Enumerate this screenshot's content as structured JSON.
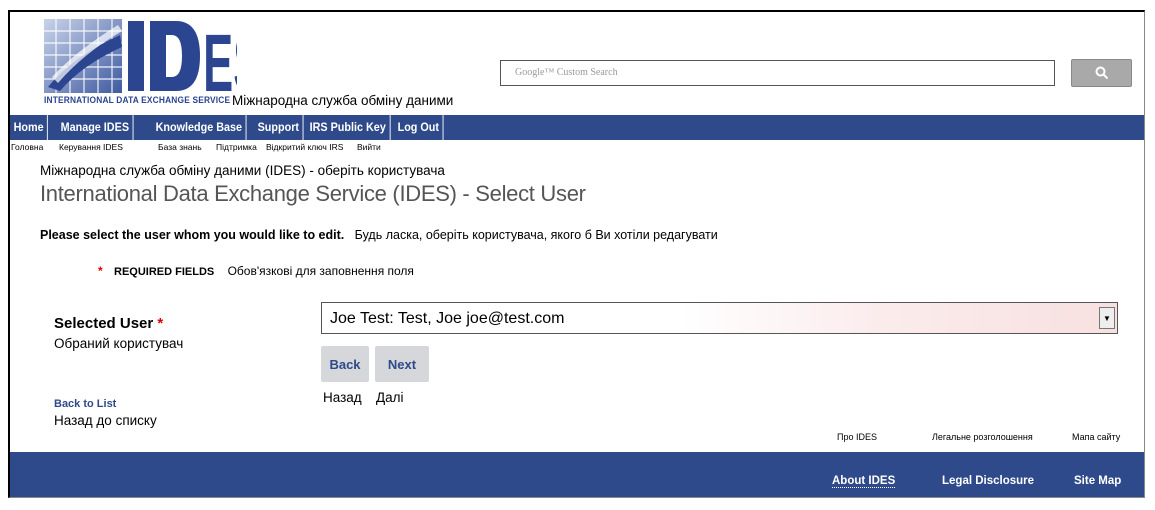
{
  "header": {
    "logo_text": "IDES",
    "logo_tagline": "INTERNATIONAL DATA EXCHANGE SERVICE",
    "logo_ua": "Міжнародна служба обміну даними",
    "search_placeholder": "Google™ Custom Search"
  },
  "nav": {
    "items": [
      {
        "label": "Home",
        "ua": "Головна"
      },
      {
        "label": "Manage IDES",
        "ua": "Керування IDES"
      },
      {
        "label": "Knowledge Base",
        "ua": "База знань"
      },
      {
        "label": "Support",
        "ua": "Підтримка"
      },
      {
        "label": "IRS Public Key",
        "ua": "Відкритий ключ IRS"
      },
      {
        "label": "Log Out",
        "ua": "Вийти"
      }
    ]
  },
  "page": {
    "subtitle_ua": "Міжнародна служба обміну даними (IDES) - оберіть користувача",
    "title": "International Data Exchange Service (IDES) - Select User",
    "instruction": "Please select the user whom you would like to edit.",
    "instruction_ua": "Будь ласка, оберіть користувача, якого б Ви хотіли редагувати",
    "required_label": "REQUIRED FIELDS",
    "required_ua": "Обов'язкові для заповнення поля"
  },
  "form": {
    "selected_user_label": "Selected User",
    "selected_user_ua": "Обраний користувач",
    "selected_user_value": "Joe Test: Test, Joe joe@test.com",
    "back_label": "Back",
    "back_ua": "Назад",
    "next_label": "Next",
    "next_ua": "Далі"
  },
  "links": {
    "back_to_list": "Back to List",
    "back_to_list_ua": "Назад до списку"
  },
  "footer": {
    "about": "About IDES",
    "about_ua": "Про IDES",
    "legal": "Legal Disclosure",
    "legal_ua": "Легальне розголошення",
    "sitemap": "Site Map",
    "sitemap_ua": "Мапа сайту"
  },
  "colors": {
    "brand_blue": "#2e4a8a",
    "required_red": "#dd0000"
  }
}
